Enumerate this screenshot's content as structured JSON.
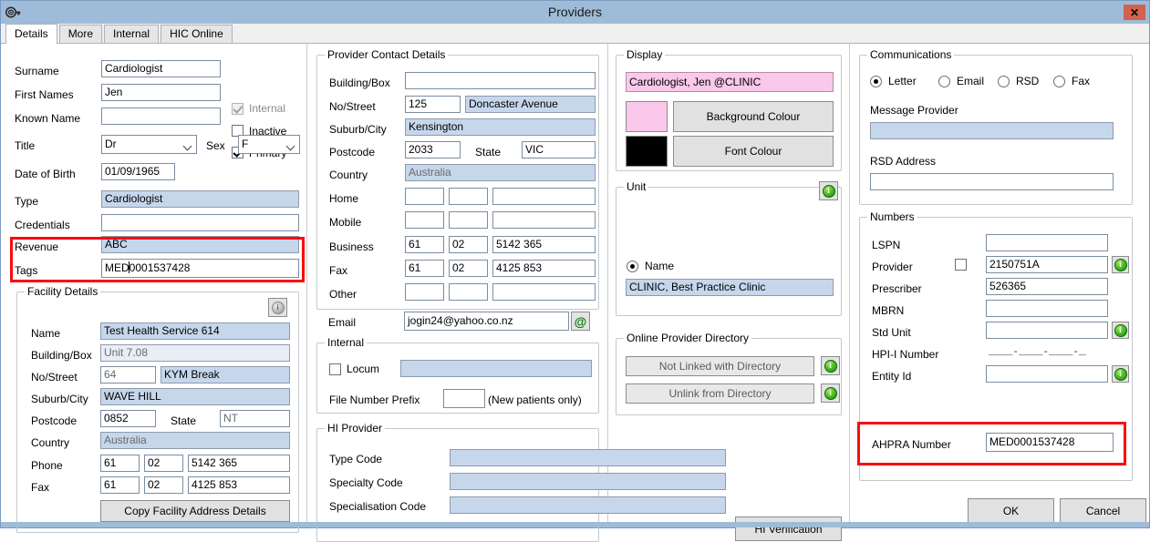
{
  "window": {
    "title": "Providers",
    "icon": "provider-key-icon",
    "close_label": "✕",
    "accent_titlebar": "#9ebcd8",
    "close_color": "#d2614f",
    "highlight_color": "#fb0c0c"
  },
  "tabs": [
    {
      "label": "Details",
      "active": true
    },
    {
      "label": "More",
      "active": false
    },
    {
      "label": "Internal",
      "active": false
    },
    {
      "label": "HIC Online",
      "active": false
    }
  ],
  "personal": {
    "surname_label": "Surname",
    "surname_value": "Cardiologist",
    "first_names_label": "First Names",
    "first_names_value": "Jen",
    "known_name_label": "Known Name",
    "known_name_value": "",
    "title_label": "Title",
    "title_value": "Dr",
    "sex_label": "Sex",
    "sex_value": "F",
    "dob_label": "Date of Birth",
    "dob_value": "01/09/1965",
    "type_label": "Type",
    "type_value": "Cardiologist",
    "credentials_label": "Credentials",
    "credentials_value": "",
    "revenue_label": "Revenue",
    "revenue_value": "ABC",
    "tags_label": "Tags",
    "tags_value_before_caret": "MED",
    "tags_value_after_caret": "0001537428",
    "checkboxes": [
      {
        "label": "Internal",
        "checked": true,
        "disabled": true
      },
      {
        "label": "Inactive",
        "checked": false,
        "disabled": false
      },
      {
        "label": "Primary",
        "checked": true,
        "disabled": false
      }
    ]
  },
  "facility": {
    "title": "Facility Details",
    "info_icon": "info-icon",
    "name_label": "Name",
    "name_value": "Test Health Service 614",
    "building_label": "Building/Box",
    "building_value": "Unit 7.08",
    "street_no_label": "No/Street",
    "street_no_value": "64",
    "street_name_value": "KYM Break",
    "suburb_label": "Suburb/City",
    "suburb_value": "WAVE HILL",
    "postcode_label": "Postcode",
    "postcode_value": "0852",
    "state_label": "State",
    "state_value": "NT",
    "country_label": "Country",
    "country_value": "Australia",
    "phone_label": "Phone",
    "phone_country": "61",
    "phone_area": "02",
    "phone_number": "5142 365",
    "fax_label": "Fax",
    "fax_country": "61",
    "fax_area": "02",
    "fax_number": "4125 853",
    "copy_button": "Copy Facility Address Details"
  },
  "contact": {
    "title": "Provider Contact Details",
    "building_label": "Building/Box",
    "building_value": "",
    "street_no_label": "No/Street",
    "street_no_value": "125",
    "street_name_value": "Doncaster Avenue",
    "suburb_label": "Suburb/City",
    "suburb_value": "Kensington",
    "postcode_label": "Postcode",
    "postcode_value": "2033",
    "state_label": "State",
    "state_value": "VIC",
    "country_label": "Country",
    "country_value": "Australia",
    "home_label": "Home",
    "home_country": "",
    "home_area": "",
    "home_number": "",
    "mobile_label": "Mobile",
    "mobile_country": "",
    "mobile_area": "",
    "mobile_number": "",
    "business_label": "Business",
    "business_country": "61",
    "business_area": "02",
    "business_number": "5142 365",
    "fax_label": "Fax",
    "fax_country": "61",
    "fax_area": "02",
    "fax_number": "4125 853",
    "other_label": "Other",
    "other_country": "",
    "other_area": "",
    "other_number": "",
    "email_label": "Email",
    "email_value": "jogin24@yahoo.co.nz",
    "email_button_icon": "at-sign-icon"
  },
  "internal": {
    "title": "Internal",
    "locum_label": "Locum",
    "locum_checked": false,
    "locum_value": "",
    "file_prefix_label": "File Number Prefix",
    "file_prefix_value": "",
    "file_prefix_note": "(New patients only)"
  },
  "hi_provider": {
    "title": "HI Provider",
    "type_code_label": "Type Code",
    "type_code_value": "",
    "specialty_code_label": "Specialty Code",
    "specialty_code_value": "",
    "specialisation_code_label": "Specialisation Code",
    "specialisation_code_value": "",
    "verification_button": "HI Verification"
  },
  "display": {
    "title": "Display",
    "preview_text": "Cardiologist, Jen @CLINIC",
    "background_colour_value": "#f9c8ea",
    "font_colour_value": "#000000",
    "background_button": "Background Colour",
    "font_button": "Font Colour"
  },
  "unit": {
    "title": "Unit",
    "info_icon": "info-icon",
    "name_radio_label": "Name",
    "name_radio_selected": true,
    "name_value": "CLINIC, Best Practice Clinic"
  },
  "directory": {
    "title": "Online Provider Directory",
    "not_linked_button": "Not Linked with Directory",
    "unlink_button": "Unlink from Directory",
    "info_icon": "info-icon"
  },
  "communications": {
    "title": "Communications",
    "options": [
      {
        "label": "Letter",
        "selected": true
      },
      {
        "label": "Email",
        "selected": false
      },
      {
        "label": "RSD",
        "selected": false
      },
      {
        "label": "Fax",
        "selected": false
      }
    ],
    "message_provider_label": "Message Provider",
    "message_provider_value": "",
    "rsd_address_label": "RSD Address",
    "rsd_address_value": ""
  },
  "numbers": {
    "title": "Numbers",
    "lspn_label": "LSPN",
    "lspn_value": "",
    "provider_label": "Provider",
    "provider_checked": false,
    "provider_value": "2150751A",
    "prescriber_label": "Prescriber",
    "prescriber_value": "526365",
    "mbrn_label": "MBRN",
    "mbrn_value": "",
    "std_unit_label": "Std Unit",
    "std_unit_value": "",
    "hpii_label": "HPI-I Number",
    "hpii_value": "____-____-____-____",
    "entity_id_label": "Entity Id",
    "entity_id_value": "",
    "ahpra_label": "AHPRA Number",
    "ahpra_value": "MED0001537428"
  },
  "actions": {
    "ok_label": "OK",
    "cancel_label": "Cancel"
  }
}
